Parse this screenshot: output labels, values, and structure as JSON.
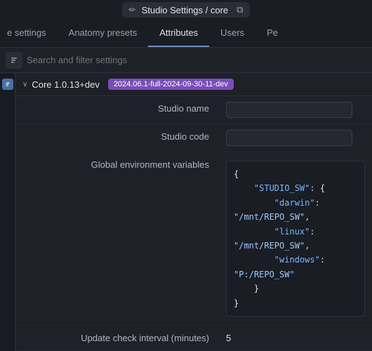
{
  "titleBar": {
    "icon": "✏",
    "title": "Studio Settings / core",
    "copyIcon": "⧉"
  },
  "tabs": [
    {
      "id": "settings",
      "label": "e settings",
      "active": false
    },
    {
      "id": "anatomy-presets",
      "label": "Anatomy presets",
      "active": false
    },
    {
      "id": "attributes",
      "label": "Attributes",
      "active": true
    },
    {
      "id": "users",
      "label": "Users",
      "active": false
    },
    {
      "id": "pe",
      "label": "Pe",
      "active": false
    }
  ],
  "search": {
    "placeholder": "Search and filter settings"
  },
  "section": {
    "chevron": "∨",
    "title": "Core 1.0.13+dev",
    "badge": "2024.06.1-full-2024-09-30-11-dev"
  },
  "settings": [
    {
      "label": "Studio name",
      "type": "input",
      "value": ""
    },
    {
      "label": "Studio code",
      "type": "input",
      "value": ""
    },
    {
      "label": "Global environment variables",
      "type": "code"
    },
    {
      "label": "Update check interval (minutes)",
      "type": "text",
      "value": "5"
    }
  ],
  "code": {
    "lines": [
      {
        "indent": 0,
        "content": "{"
      },
      {
        "indent": 1,
        "key": "\"STUDIO_SW\"",
        "brace": "{"
      },
      {
        "indent": 2,
        "key": "\"darwin\"",
        "value": "\"/mnt/REPO_SW\","
      },
      {
        "indent": 2,
        "key": "\"linux\"",
        "value": "\"/mnt/REPO_SW\","
      },
      {
        "indent": 2,
        "key": "\"windows\"",
        "value": "\"P:/REPO_SW\""
      },
      {
        "indent": 1,
        "closebrace": "}"
      },
      {
        "indent": 0,
        "content": "}"
      }
    ]
  },
  "icons": {
    "pencil": "✏",
    "copy": "⧉",
    "chevronDown": "›",
    "sidebarDot": "■"
  }
}
